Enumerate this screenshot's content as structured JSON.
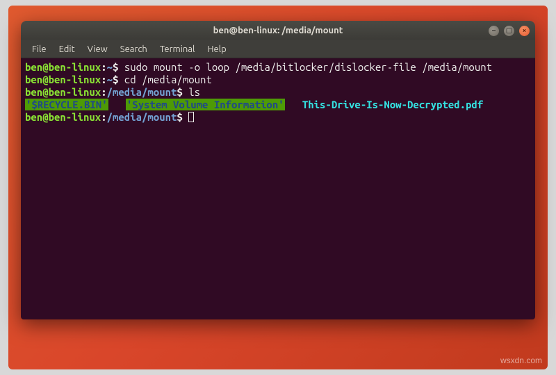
{
  "window": {
    "title": "ben@ben-linux: /media/mount"
  },
  "menubar": {
    "items": [
      "File",
      "Edit",
      "View",
      "Search",
      "Terminal",
      "Help"
    ]
  },
  "prompts": {
    "userhost": "ben@ben-linux",
    "sep": ":",
    "dollar": "$",
    "home_path": "~",
    "mount_path": "/media/mount"
  },
  "commands": {
    "cmd1": "sudo mount -o loop /media/bitlocker/dislocker-file /media/mount",
    "cmd2": "cd /media/mount",
    "cmd3": "ls"
  },
  "ls_output": {
    "item1": "'$RECYCLE.BIN'",
    "item2": "'System Volume Information'",
    "item3": "This-Drive-Is-Now-Decrypted.pdf"
  },
  "watermark": "wsxdn.com"
}
